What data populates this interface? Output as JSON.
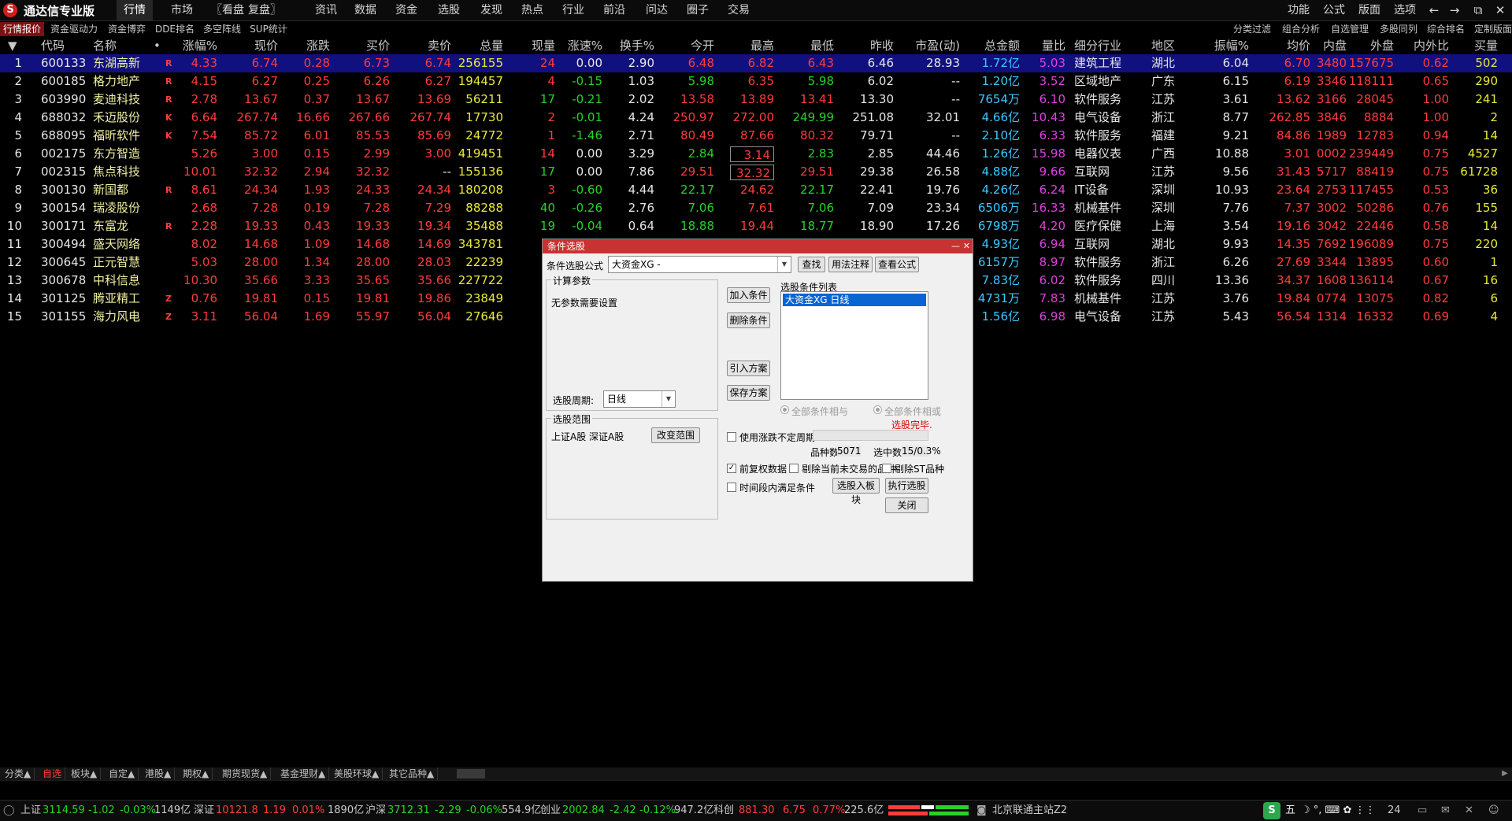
{
  "app": {
    "title": "通达信专业版"
  },
  "menu": [
    "行情",
    "市场",
    "〖看盘",
    "复盘〗",
    "资讯",
    "数据",
    "资金",
    "选股",
    "发现",
    "热点",
    "行业",
    "前沿",
    "问达",
    "圈子",
    "交易"
  ],
  "right_menu": [
    "功能",
    "公式",
    "版面",
    "选项"
  ],
  "window_buttons": [
    "back-icon",
    "forward-icon",
    "restore-icon",
    "minimize-icon",
    "maximize-icon",
    "close-icon"
  ],
  "window_glyphs": [
    "←",
    "→",
    "⧉",
    "—",
    "□",
    "✕"
  ],
  "sub_tabs": [
    "行情报价",
    "资金驱动力",
    "资金博弈",
    "DDE排名",
    "多空阵线",
    "SUP统计"
  ],
  "sub_tabs_right": [
    "分类过滤",
    "组合分析",
    "自选管理",
    "多股同列",
    "综合排名",
    "定制版面"
  ],
  "table": {
    "sort_marker": "▼",
    "sort_dot": "•",
    "headers": [
      "代码",
      "名称",
      "涨幅%",
      "现价",
      "涨跌",
      "买价",
      "卖价",
      "总量",
      "现量",
      "涨速%",
      "换手%",
      "今开",
      "最高",
      "最低",
      "昨收",
      "市盈(动)",
      "总金额",
      "量比",
      "细分行业",
      "地区",
      "振幅%",
      "均价",
      "内盘",
      "外盘",
      "内外比",
      "买量"
    ],
    "rows": [
      {
        "idx": "1",
        "code": "600133",
        "name": "东湖高新",
        "flag": "R",
        "chg": "4.33",
        "price": "6.74",
        "diff": "0.28",
        "bid": "6.73",
        "ask": "6.74",
        "vol": "256155",
        "cur": "24",
        "spd": "0.00",
        "turn": "2.90",
        "open": "6.48",
        "high": "6.82",
        "low": "6.43",
        "prev": "6.46",
        "pe": "28.93",
        "amt": "1.72亿",
        "ratio": "5.03",
        "ind": "建筑工程",
        "area": "湖北",
        "amp": "6.04",
        "avg": "6.70",
        "inner": "3480",
        "outer": "157675",
        "io": "0.62",
        "bv": "502",
        "cls": {
          "chg": "red",
          "price": "red",
          "diff": "red",
          "bid": "red",
          "ask": "red",
          "vol": "yel",
          "cur": "red",
          "spd": "wht",
          "open": "red",
          "high": "red",
          "low": "red",
          "avg": "red"
        }
      },
      {
        "idx": "2",
        "code": "600185",
        "name": "格力地产",
        "flag": "R",
        "chg": "4.15",
        "price": "6.27",
        "diff": "0.25",
        "bid": "6.26",
        "ask": "6.27",
        "vol": "194457",
        "cur": "4",
        "spd": "-0.15",
        "turn": "1.03",
        "open": "5.98",
        "high": "6.35",
        "low": "5.98",
        "prev": "6.02",
        "pe": "--",
        "amt": "1.20亿",
        "ratio": "3.52",
        "ind": "区域地产",
        "area": "广东",
        "amp": "6.15",
        "avg": "6.19",
        "inner": "3346",
        "outer": "118111",
        "io": "0.65",
        "bv": "290",
        "cls": {
          "chg": "red",
          "price": "red",
          "diff": "red",
          "bid": "red",
          "ask": "red",
          "vol": "yel",
          "cur": "red",
          "spd": "grn",
          "open": "grn",
          "high": "red",
          "low": "grn",
          "avg": "red"
        }
      },
      {
        "idx": "3",
        "code": "603990",
        "name": "麦迪科技",
        "flag": "R",
        "chg": "2.78",
        "price": "13.67",
        "diff": "0.37",
        "bid": "13.67",
        "ask": "13.69",
        "vol": "56211",
        "cur": "17",
        "spd": "-0.21",
        "turn": "2.02",
        "open": "13.58",
        "high": "13.89",
        "low": "13.41",
        "prev": "13.30",
        "pe": "--",
        "amt": "7654万",
        "ratio": "6.10",
        "ind": "软件服务",
        "area": "江苏",
        "amp": "3.61",
        "avg": "13.62",
        "inner": "3166",
        "outer": "28045",
        "io": "1.00",
        "bv": "241",
        "cls": {
          "chg": "red",
          "price": "red",
          "diff": "red",
          "bid": "red",
          "ask": "red",
          "vol": "yel",
          "cur": "grn",
          "spd": "grn",
          "open": "red",
          "high": "red",
          "low": "red",
          "avg": "red"
        }
      },
      {
        "idx": "4",
        "code": "688032",
        "name": "禾迈股份",
        "flag": "K",
        "chg": "6.64",
        "price": "267.74",
        "diff": "16.66",
        "bid": "267.66",
        "ask": "267.74",
        "vol": "17730",
        "cur": "2",
        "spd": "-0.01",
        "turn": "4.24",
        "open": "250.97",
        "high": "272.00",
        "low": "249.99",
        "prev": "251.08",
        "pe": "32.01",
        "amt": "4.66亿",
        "ratio": "10.43",
        "ind": "电气设备",
        "area": "浙江",
        "amp": "8.77",
        "avg": "262.85",
        "inner": "3846",
        "outer": "8884",
        "io": "1.00",
        "bv": "2",
        "cls": {
          "chg": "red",
          "price": "red",
          "diff": "red",
          "bid": "red",
          "ask": "red",
          "vol": "yel",
          "cur": "red",
          "spd": "grn",
          "open": "red",
          "high": "red",
          "low": "grn",
          "avg": "red"
        }
      },
      {
        "idx": "5",
        "code": "688095",
        "name": "福昕软件",
        "flag": "K",
        "chg": "7.54",
        "price": "85.72",
        "diff": "6.01",
        "bid": "85.53",
        "ask": "85.69",
        "vol": "24772",
        "cur": "1",
        "spd": "-1.46",
        "turn": "2.71",
        "open": "80.49",
        "high": "87.66",
        "low": "80.32",
        "prev": "79.71",
        "pe": "--",
        "amt": "2.10亿",
        "ratio": "6.33",
        "ind": "软件服务",
        "area": "福建",
        "amp": "9.21",
        "avg": "84.86",
        "inner": "1989",
        "outer": "12783",
        "io": "0.94",
        "bv": "14",
        "cls": {
          "chg": "red",
          "price": "red",
          "diff": "red",
          "bid": "red",
          "ask": "red",
          "vol": "yel",
          "cur": "red",
          "spd": "grn",
          "open": "red",
          "high": "red",
          "low": "red",
          "avg": "red"
        }
      },
      {
        "idx": "6",
        "code": "002175",
        "name": "东方智造",
        "flag": "",
        "chg": "5.26",
        "price": "3.00",
        "diff": "0.15",
        "bid": "2.99",
        "ask": "3.00",
        "vol": "419451",
        "cur": "14",
        "spd": "0.00",
        "turn": "3.29",
        "open": "2.84",
        "high": "3.14",
        "low": "2.83",
        "prev": "2.85",
        "pe": "44.46",
        "amt": "1.26亿",
        "ratio": "15.98",
        "ind": "电器仪表",
        "area": "广西",
        "amp": "10.88",
        "avg": "3.01",
        "inner": "0002",
        "outer": "239449",
        "io": "0.75",
        "bv": "4527",
        "boxed": true,
        "cls": {
          "chg": "red",
          "price": "red",
          "diff": "red",
          "bid": "red",
          "ask": "red",
          "vol": "yel",
          "cur": "red",
          "spd": "wht",
          "open": "grn",
          "high": "red",
          "low": "grn",
          "avg": "red"
        }
      },
      {
        "idx": "7",
        "code": "002315",
        "name": "焦点科技",
        "flag": "",
        "chg": "10.01",
        "price": "32.32",
        "diff": "2.94",
        "bid": "32.32",
        "ask": "--",
        "vol": "155136",
        "cur": "17",
        "spd": "0.00",
        "turn": "7.86",
        "open": "29.51",
        "high": "32.32",
        "low": "29.51",
        "prev": "29.38",
        "pe": "26.58",
        "amt": "4.88亿",
        "ratio": "9.66",
        "ind": "互联网",
        "area": "江苏",
        "amp": "9.56",
        "avg": "31.43",
        "inner": "5717",
        "outer": "88419",
        "io": "0.75",
        "bv": "61728",
        "boxed": true,
        "cls": {
          "chg": "red",
          "price": "red",
          "diff": "red",
          "bid": "red",
          "ask": "wht",
          "vol": "yel",
          "cur": "grn",
          "spd": "wht",
          "open": "red",
          "high": "red",
          "low": "red",
          "avg": "red"
        }
      },
      {
        "idx": "8",
        "code": "300130",
        "name": "新国都",
        "flag": "R",
        "chg": "8.61",
        "price": "24.34",
        "diff": "1.93",
        "bid": "24.33",
        "ask": "24.34",
        "vol": "180208",
        "cur": "3",
        "spd": "-0.60",
        "turn": "4.44",
        "open": "22.17",
        "high": "24.62",
        "low": "22.17",
        "prev": "22.41",
        "pe": "19.76",
        "amt": "4.26亿",
        "ratio": "6.24",
        "ind": "IT设备",
        "area": "深圳",
        "amp": "10.93",
        "avg": "23.64",
        "inner": "2753",
        "outer": "117455",
        "io": "0.53",
        "bv": "36",
        "cls": {
          "chg": "red",
          "price": "red",
          "diff": "red",
          "bid": "red",
          "ask": "red",
          "vol": "yel",
          "cur": "red",
          "spd": "grn",
          "open": "grn",
          "high": "red",
          "low": "grn",
          "avg": "red"
        }
      },
      {
        "idx": "9",
        "code": "300154",
        "name": "瑞凌股份",
        "flag": "",
        "chg": "2.68",
        "price": "7.28",
        "diff": "0.19",
        "bid": "7.28",
        "ask": "7.29",
        "vol": "88288",
        "cur": "40",
        "spd": "-0.26",
        "turn": "2.76",
        "open": "7.06",
        "high": "7.61",
        "low": "7.06",
        "prev": "7.09",
        "pe": "23.34",
        "amt": "6506万",
        "ratio": "16.33",
        "ind": "机械基件",
        "area": "深圳",
        "amp": "7.76",
        "avg": "7.37",
        "inner": "3002",
        "outer": "50286",
        "io": "0.76",
        "bv": "155",
        "cls": {
          "chg": "red",
          "price": "red",
          "diff": "red",
          "bid": "red",
          "ask": "red",
          "vol": "yel",
          "cur": "grn",
          "spd": "grn",
          "open": "grn",
          "high": "red",
          "low": "grn",
          "avg": "red"
        }
      },
      {
        "idx": "10",
        "code": "300171",
        "name": "东富龙",
        "flag": "R",
        "chg": "2.28",
        "price": "19.33",
        "diff": "0.43",
        "bid": "19.33",
        "ask": "19.34",
        "vol": "35488",
        "cur": "19",
        "spd": "-0.04",
        "turn": "0.64",
        "open": "18.88",
        "high": "19.44",
        "low": "18.77",
        "prev": "18.90",
        "pe": "17.26",
        "amt": "6798万",
        "ratio": "4.20",
        "ind": "医疗保健",
        "area": "上海",
        "amp": "3.54",
        "avg": "19.16",
        "inner": "3042",
        "outer": "22446",
        "io": "0.58",
        "bv": "14",
        "cls": {
          "chg": "red",
          "price": "red",
          "diff": "red",
          "bid": "red",
          "ask": "red",
          "vol": "yel",
          "cur": "grn",
          "spd": "grn",
          "open": "grn",
          "high": "red",
          "low": "grn",
          "avg": "red"
        }
      },
      {
        "idx": "11",
        "code": "300494",
        "name": "盛天网络",
        "flag": "",
        "chg": "8.02",
        "price": "14.68",
        "diff": "1.09",
        "bid": "14.68",
        "ask": "14.69",
        "vol": "343781",
        "cur": "",
        "spd": "",
        "turn": "",
        "open": "",
        "high": "",
        "low": "",
        "prev": "",
        "pe": "",
        "amt": "4.93亿",
        "ratio": "6.94",
        "ind": "互联网",
        "area": "湖北",
        "amp": "9.93",
        "avg": "14.35",
        "inner": "7692",
        "outer": "196089",
        "io": "0.75",
        "bv": "220",
        "cls": {
          "chg": "red",
          "price": "red",
          "diff": "red",
          "bid": "red",
          "ask": "red",
          "vol": "yel",
          "cur": "red",
          "spd": "wht",
          "open": "red",
          "high": "red",
          "low": "red",
          "avg": "red"
        }
      },
      {
        "idx": "12",
        "code": "300645",
        "name": "正元智慧",
        "flag": "",
        "chg": "5.03",
        "price": "28.00",
        "diff": "1.34",
        "bid": "28.00",
        "ask": "28.03",
        "vol": "22239",
        "cur": "",
        "spd": "",
        "turn": "",
        "open": "",
        "high": "",
        "low": "",
        "prev": "",
        "pe": "",
        "amt": "6157万",
        "ratio": "8.97",
        "ind": "软件服务",
        "area": "浙江",
        "amp": "6.26",
        "avg": "27.69",
        "inner": "3344",
        "outer": "13895",
        "io": "0.60",
        "bv": "1",
        "cls": {
          "chg": "red",
          "price": "red",
          "diff": "red",
          "bid": "red",
          "ask": "red",
          "vol": "yel",
          "cur": "red",
          "spd": "wht",
          "open": "red",
          "high": "red",
          "low": "red",
          "avg": "red"
        }
      },
      {
        "idx": "13",
        "code": "300678",
        "name": "中科信息",
        "flag": "",
        "chg": "10.30",
        "price": "35.66",
        "diff": "3.33",
        "bid": "35.65",
        "ask": "35.66",
        "vol": "227722",
        "cur": "",
        "spd": "",
        "turn": "",
        "open": "",
        "high": "",
        "low": "",
        "prev": "",
        "pe": "",
        "amt": "7.83亿",
        "ratio": "6.02",
        "ind": "软件服务",
        "area": "四川",
        "amp": "13.36",
        "avg": "34.37",
        "inner": "1608",
        "outer": "136114",
        "io": "0.67",
        "bv": "16",
        "cls": {
          "chg": "red",
          "price": "red",
          "diff": "red",
          "bid": "red",
          "ask": "red",
          "vol": "yel",
          "cur": "red",
          "spd": "wht",
          "open": "red",
          "high": "red",
          "low": "red",
          "avg": "red"
        }
      },
      {
        "idx": "14",
        "code": "301125",
        "name": "腾亚精工",
        "flag": "Z",
        "chg": "0.76",
        "price": "19.81",
        "diff": "0.15",
        "bid": "19.81",
        "ask": "19.86",
        "vol": "23849",
        "cur": "",
        "spd": "",
        "turn": "",
        "open": "",
        "high": "",
        "low": "",
        "prev": "",
        "pe": "",
        "amt": "4731万",
        "ratio": "7.83",
        "ind": "机械基件",
        "area": "江苏",
        "amp": "3.76",
        "avg": "19.84",
        "inner": "0774",
        "outer": "13075",
        "io": "0.82",
        "bv": "6",
        "cls": {
          "chg": "red",
          "price": "red",
          "diff": "red",
          "bid": "red",
          "ask": "red",
          "vol": "yel",
          "cur": "red",
          "spd": "wht",
          "open": "red",
          "high": "red",
          "low": "red",
          "avg": "red"
        }
      },
      {
        "idx": "15",
        "code": "301155",
        "name": "海力风电",
        "flag": "Z",
        "chg": "3.11",
        "price": "56.04",
        "diff": "1.69",
        "bid": "55.97",
        "ask": "56.04",
        "vol": "27646",
        "cur": "",
        "spd": "",
        "turn": "",
        "open": "",
        "high": "",
        "low": "",
        "prev": "",
        "pe": "",
        "amt": "1.56亿",
        "ratio": "6.98",
        "ind": "电气设备",
        "area": "江苏",
        "amp": "5.43",
        "avg": "56.54",
        "inner": "1314",
        "outer": "16332",
        "io": "0.69",
        "bv": "4",
        "cls": {
          "chg": "red",
          "price": "red",
          "diff": "red",
          "bid": "red",
          "ask": "red",
          "vol": "yel",
          "cur": "red",
          "spd": "wht",
          "open": "red",
          "high": "red",
          "low": "red",
          "avg": "red"
        }
      }
    ]
  },
  "dialog": {
    "title": "条件选股",
    "formula_label": "条件选股公式",
    "formula_value": "大资金XG    -",
    "find_btn": "查找",
    "usage_btn": "用法注释",
    "view_formula_btn": "查看公式",
    "params_title": "计算参数",
    "params_text": "无参数需要设置",
    "period_label": "选股周期:",
    "period_value": "日线",
    "add_btn": "加入条件",
    "delete_btn": "删除条件",
    "import_btn": "引入方案",
    "save_btn": "保存方案",
    "list_title": "选股条件列表",
    "list_items": [
      "大资金XG  日线"
    ],
    "radio_and": "全部条件相与",
    "radio_or": "全部条件相或",
    "done_text": "选股完毕.",
    "scope_title": "选股范围",
    "scope_text": "上证A股 深证A股",
    "change_scope_btn": "改变范围",
    "uncertain_period_label": "使用涨跌不定周期",
    "count_label": "品种数",
    "count_value": "5071",
    "selected_label": "选中数",
    "selected_value": "15/0.3%",
    "pre_adjust_label": "前复权数据",
    "pre_adjust_checked": "✓",
    "exclude_untraded_label": "剔除当前未交易的品种",
    "exclude_st_label": "剔除ST品种",
    "time_period_label": "时间段内满足条件",
    "to_block_btn": "选股入板块",
    "run_btn": "执行选股",
    "close_btn": "关闭"
  },
  "category_tabs": [
    "分类▲",
    "自选",
    "板块▲",
    "自定▲",
    "港股▲",
    "期权▲",
    "期货现货▲",
    "基金理财▲",
    "美股环球▲",
    "其它品种▲"
  ],
  "status": {
    "sh_label": "上证",
    "sh_val": "3114.59",
    "sh_chg": "-1.02",
    "sh_pct": "-0.03%",
    "sh_amt": "1149亿",
    "sz_label": "深证",
    "sz_val": "10121.8",
    "sz_chg": "1.19",
    "sz_pct": "0.01%",
    "sz_amt": "1890亿",
    "hs_label": "沪深",
    "hs_val": "3712.31",
    "hs_chg": "-2.29",
    "hs_pct": "-0.06%",
    "hs_amt": "554.9亿",
    "cy_label": "创业",
    "cy_val": "2002.84",
    "cy_chg": "-2.42",
    "cy_pct": "-0.12%",
    "cy_amt": "947.2亿",
    "kc_label": "科创",
    "kc_val": "881.30",
    "kc_chg": "6.75",
    "kc_pct": "0.77%",
    "kc_amt": "225.6亿",
    "server": "北京联通主站Z2",
    "ime": "五",
    "ime_icons": "☽ °, ⌨ ✿ ⋮⋮",
    "time": "24"
  },
  "colors": {
    "up": "#ff3c3c",
    "down": "#28d228",
    "selected_row": "#10107e",
    "dialog_title": "#c83232",
    "amount": "#3cc8ff",
    "ratio": "#e040e0",
    "volume": "#e8e83a"
  }
}
